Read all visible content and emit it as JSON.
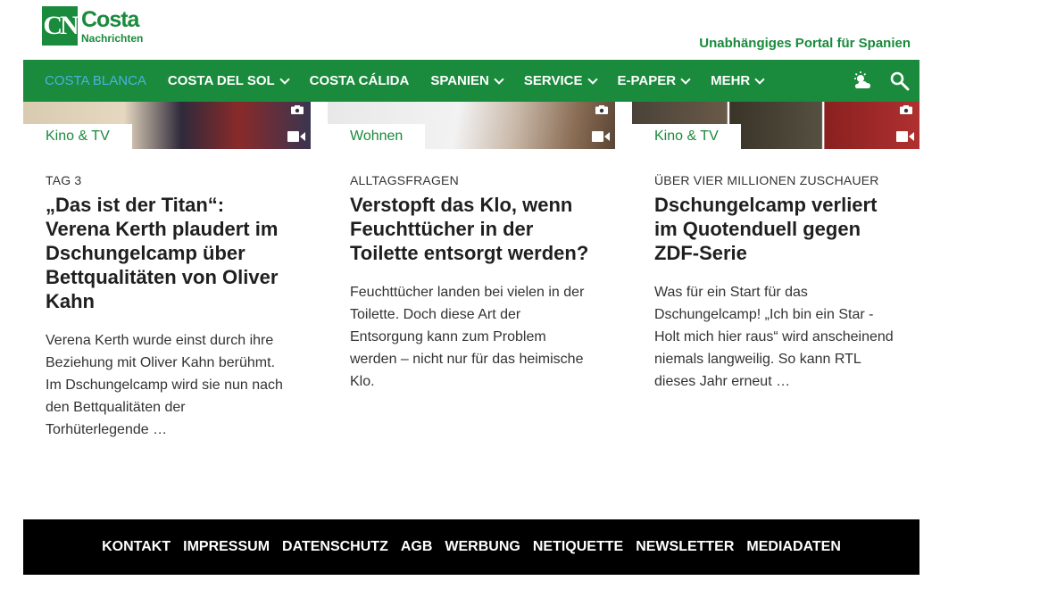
{
  "header": {
    "logo_mark": "CN",
    "logo_line1": "Costa",
    "logo_line2": "Nachrichten",
    "tagline": "Unabhängiges Portal für Spanien"
  },
  "nav": {
    "items": [
      {
        "label": "COSTA BLANCA",
        "dropdown": false
      },
      {
        "label": "COSTA DEL SOL",
        "dropdown": true
      },
      {
        "label": "COSTA CÁLIDA",
        "dropdown": false
      },
      {
        "label": "SPANIEN",
        "dropdown": true
      },
      {
        "label": "SERVICE",
        "dropdown": true
      },
      {
        "label": "E-PAPER",
        "dropdown": true
      },
      {
        "label": "MEHR",
        "dropdown": true
      }
    ],
    "icons": [
      "weather-sun-cloud-icon",
      "search-icon"
    ]
  },
  "articles": [
    {
      "tag": "Kino & TV",
      "kicker": "TAG 3",
      "headline": "„Das ist der Titan“: Verena Kerth plaudert im Dschungelcamp über Bettqualitäten von Oliver Kahn",
      "teaser": "Verena Kerth wurde einst durch ihre Beziehung mit Oliver Kahn berühmt. Im Dschungelcamp wird sie nun nach den Bettqualitäten der Torhüterlegende …"
    },
    {
      "tag": "Wohnen",
      "kicker": "ALLTAGSFRAGEN",
      "headline": "Verstopft das Klo, wenn Feuchttücher in der Toilette entsorgt werden?",
      "teaser": "Feuchttücher landen bei vielen in der Toilette. Doch diese Art der Entsorgung kann zum Problem werden – nicht nur für das heimische Klo."
    },
    {
      "tag": "Kino & TV",
      "kicker": "ÜBER VIER MILLIONEN ZUSCHAUER",
      "headline": "Dschungelcamp verliert im Quotenduell gegen ZDF-Serie",
      "teaser": "Was für ein Start für das Dschungelcamp! „Ich bin ein Star - Holt mich hier raus“ wird anscheinend niemals langweilig. So kann RTL dieses Jahr erneut …"
    }
  ],
  "footer": {
    "links": [
      "KONTAKT",
      "IMPRESSUM",
      "DATENSCHUTZ",
      "AGB",
      "WERBUNG",
      "NETIQUETTE",
      "NEWSLETTER",
      "MEDIADATEN"
    ]
  },
  "colors": {
    "brand_green": "#1a8a3c",
    "active_nav": "#4ab3e0",
    "footer_bg": "#000000"
  }
}
